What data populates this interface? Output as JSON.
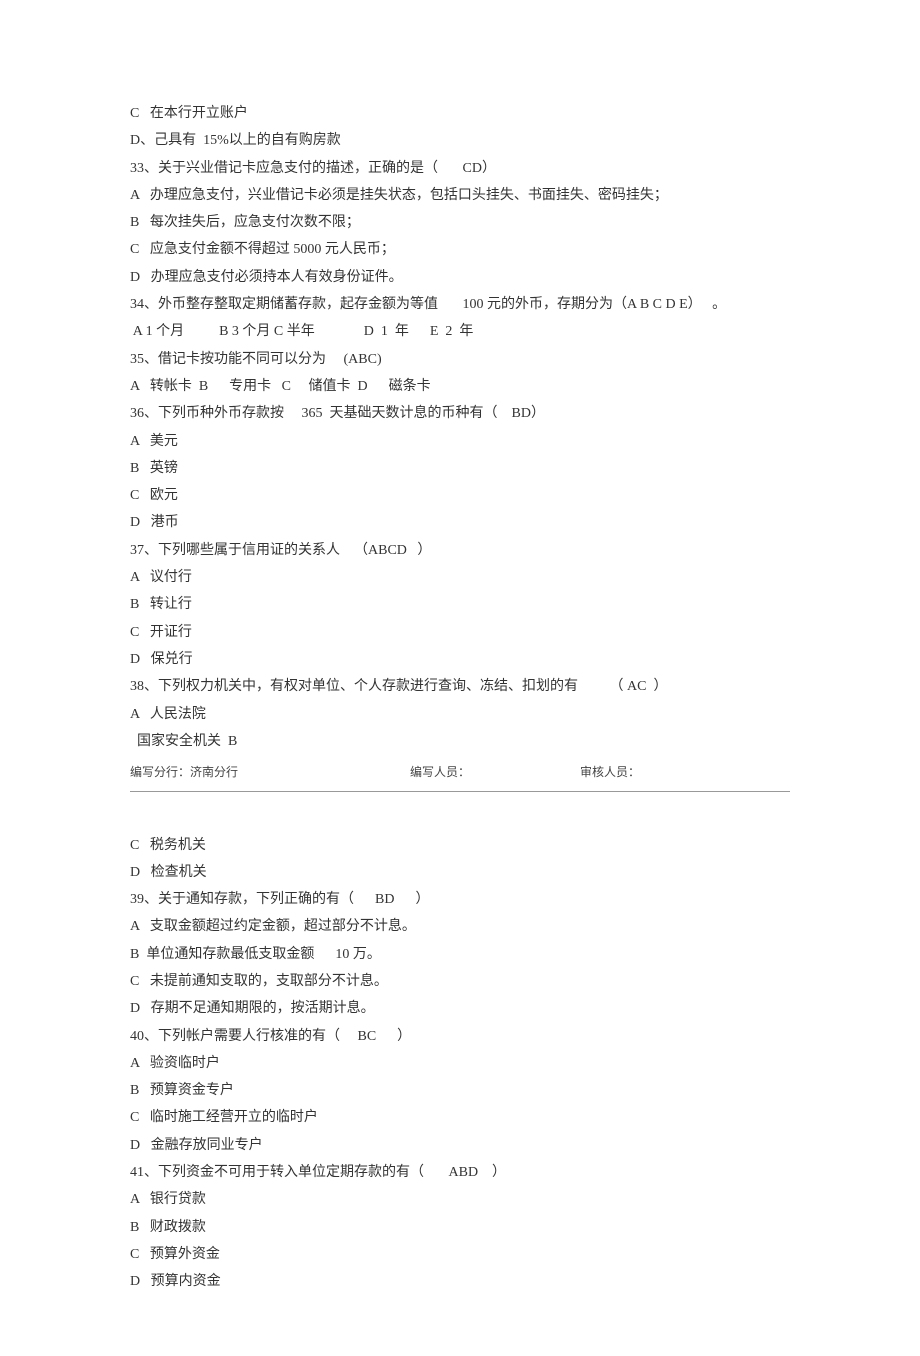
{
  "lines": {
    "l1": "C   在本行开立账户",
    "l2": "D、己具有  15%以上的自有购房款",
    "l3": "33、关于兴业借记卡应急支付的描述，正确的是（       CD）",
    "l4": "A   办理应急支付，兴业借记卡必须是挂失状态，包括口头挂失、书面挂失、密码挂失；",
    "l5": "B   每次挂失后，应急支付次数不限；",
    "l6": "C   应急支付金额不得超过 5000 元人民币；",
    "l7": "D   办理应急支付必须持本人有效身份证件。",
    "l8": "34、外币整存整取定期储蓄存款，起存金额为等值       100 元的外币，存期分为（A B C D E）   。",
    "l9": " A 1 个月          B 3 个月 C 半年              D  1  年      E  2  年",
    "l10": "35、借记卡按功能不同可以分为     (ABC)",
    "l11": "A   转帐卡  B      专用卡   C     储值卡  D      磁条卡",
    "l12": "36、下列币种外币存款按     365  天基础天数计息的币种有（    BD）",
    "l13": "A   美元",
    "l14": "B   英镑",
    "l15": "C   欧元",
    "l16": "D   港币",
    "l17": "37、下列哪些属于信用证的关系人    （ABCD   ）",
    "l18": "A   议付行",
    "l19": "B   转让行",
    "l20": "C   开证行",
    "l21": "D   保兑行",
    "l22": "38、下列权力机关中，有权对单位、个人存款进行查询、冻结、扣划的有         （ AC  ）",
    "l23": "A   人民法院",
    "l24": "  国家安全机关  B",
    "l25": "C   税务机关",
    "l26": "D   检查机关",
    "l27": "39、关于通知存款，下列正确的有（      BD      ）",
    "l28": "A   支取金额超过约定金额，超过部分不计息。",
    "l29": "B  单位通知存款最低支取金额      10 万。",
    "l30": "C   未提前通知支取的，支取部分不计息。",
    "l31": "D   存期不足通知期限的，按活期计息。",
    "l32": "40、下列帐户需要人行核准的有（     BC      ）",
    "l33": "A   验资临时户",
    "l34": "B   预算资金专户",
    "l35": "C   临时施工经营开立的临时户",
    "l36": "D   金融存放同业专户",
    "l37": "41、下列资金不可用于转入单位定期存款的有（       ABD    ）",
    "l38": "A   银行贷款",
    "l39": "B   财政拨款",
    "l40": "C   预算外资金",
    "l41": "D   预算内资金"
  },
  "footer": {
    "branch_label": "编写分行：",
    "branch_value": "济南分行",
    "writer_label": "编写人员：",
    "reviewer_label": "审核人员："
  }
}
